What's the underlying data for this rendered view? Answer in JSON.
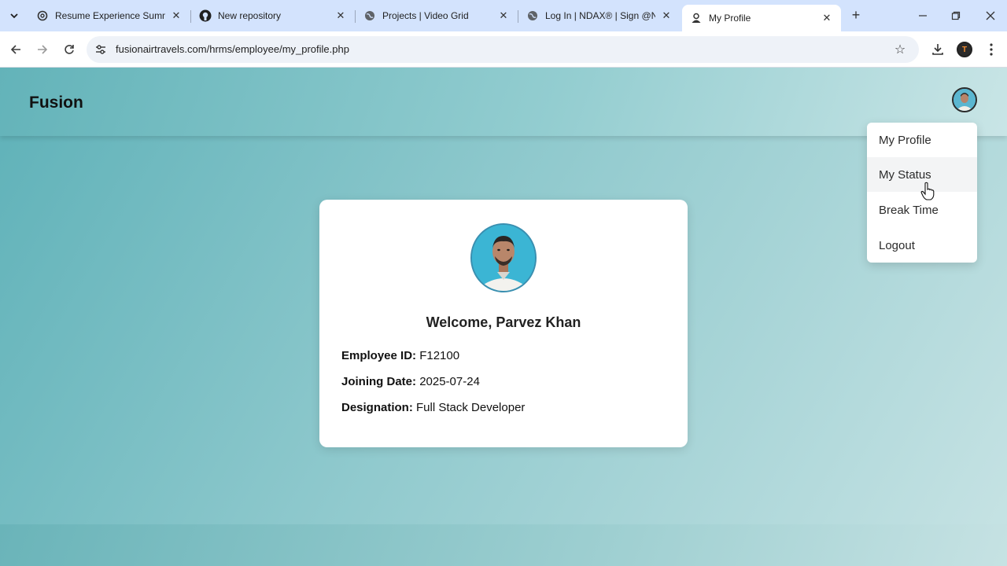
{
  "browser": {
    "tabs": [
      {
        "title": "Resume Experience Summar",
        "icon": "openai-icon"
      },
      {
        "title": "New repository",
        "icon": "github-icon"
      },
      {
        "title": "Projects | Video Grid",
        "icon": "globe-icon"
      },
      {
        "title": "Log In | NDAX® | Sign @ND",
        "icon": "globe-icon"
      },
      {
        "title": "My Profile",
        "icon": "person-icon",
        "active": true
      }
    ],
    "url": "fusionairtravels.com/hrms/employee/my_profile.php",
    "profile_initial": "T"
  },
  "site": {
    "brand": "Fusion"
  },
  "menu": {
    "items": [
      "My Profile",
      "My Status",
      "Break Time",
      "Logout"
    ],
    "hovered_index": 1
  },
  "profile": {
    "welcome": "Welcome, Parvez Khan",
    "fields": [
      {
        "label": "Employee ID:",
        "value": "F12100"
      },
      {
        "label": "Joining Date:",
        "value": "2025-07-24"
      },
      {
        "label": "Designation:",
        "value": "Full Stack Developer"
      }
    ]
  },
  "colors": {
    "page_gradient_start": "#5eb1b8",
    "page_gradient_end": "#c7e3e4",
    "tabstrip": "#d3e3fd"
  }
}
